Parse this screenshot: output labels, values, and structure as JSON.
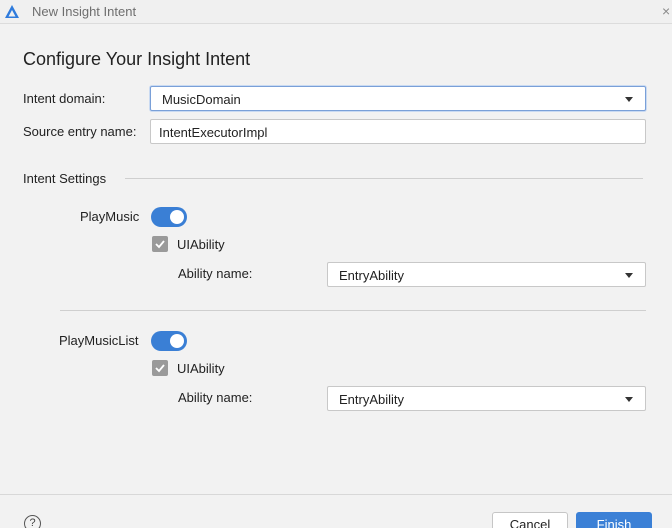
{
  "window": {
    "title": "New Insight Intent",
    "app_icon": "deveco-logo-icon",
    "close_glyph": "×"
  },
  "form": {
    "heading": "Configure Your Insight Intent",
    "intent_domain_label": "Intent domain:",
    "intent_domain_value": "MusicDomain",
    "source_entry_label": "Source entry name:",
    "source_entry_value": "IntentExecutorImpl",
    "settings_section": "Intent Settings"
  },
  "intents": [
    {
      "name": "PlayMusic",
      "enabled": true,
      "ability_type": "UIAbility",
      "ability_checked": true,
      "ability_name_label": "Ability name:",
      "ability_name_value": "EntryAbility"
    },
    {
      "name": "PlayMusicList",
      "enabled": true,
      "ability_type": "UIAbility",
      "ability_checked": true,
      "ability_name_label": "Ability name:",
      "ability_name_value": "EntryAbility"
    }
  ],
  "footer": {
    "help_icon": "question-circle-icon",
    "help_glyph": "?",
    "cancel_label": "Cancel",
    "finish_label": "Finish"
  },
  "colors": {
    "accent": "#3a7fd5",
    "checkbox": "#9a9a9a"
  }
}
